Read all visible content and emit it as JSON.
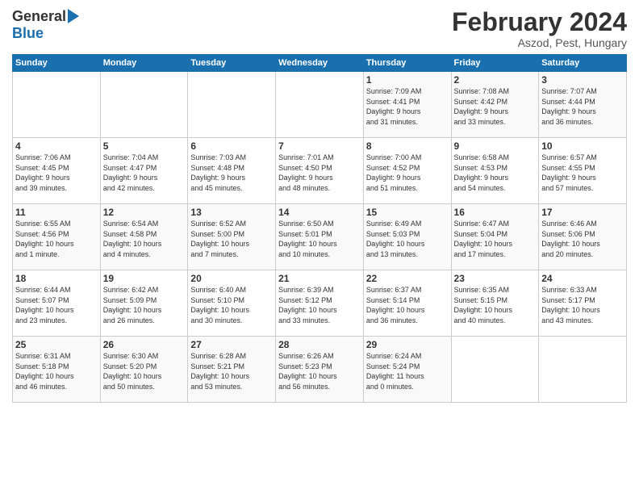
{
  "logo": {
    "general": "General",
    "blue": "Blue"
  },
  "title": "February 2024",
  "subtitle": "Aszod, Pest, Hungary",
  "weekdays": [
    "Sunday",
    "Monday",
    "Tuesday",
    "Wednesday",
    "Thursday",
    "Friday",
    "Saturday"
  ],
  "weeks": [
    [
      {
        "day": "",
        "info": ""
      },
      {
        "day": "",
        "info": ""
      },
      {
        "day": "",
        "info": ""
      },
      {
        "day": "",
        "info": ""
      },
      {
        "day": "1",
        "info": "Sunrise: 7:09 AM\nSunset: 4:41 PM\nDaylight: 9 hours\nand 31 minutes."
      },
      {
        "day": "2",
        "info": "Sunrise: 7:08 AM\nSunset: 4:42 PM\nDaylight: 9 hours\nand 33 minutes."
      },
      {
        "day": "3",
        "info": "Sunrise: 7:07 AM\nSunset: 4:44 PM\nDaylight: 9 hours\nand 36 minutes."
      }
    ],
    [
      {
        "day": "4",
        "info": "Sunrise: 7:06 AM\nSunset: 4:45 PM\nDaylight: 9 hours\nand 39 minutes."
      },
      {
        "day": "5",
        "info": "Sunrise: 7:04 AM\nSunset: 4:47 PM\nDaylight: 9 hours\nand 42 minutes."
      },
      {
        "day": "6",
        "info": "Sunrise: 7:03 AM\nSunset: 4:48 PM\nDaylight: 9 hours\nand 45 minutes."
      },
      {
        "day": "7",
        "info": "Sunrise: 7:01 AM\nSunset: 4:50 PM\nDaylight: 9 hours\nand 48 minutes."
      },
      {
        "day": "8",
        "info": "Sunrise: 7:00 AM\nSunset: 4:52 PM\nDaylight: 9 hours\nand 51 minutes."
      },
      {
        "day": "9",
        "info": "Sunrise: 6:58 AM\nSunset: 4:53 PM\nDaylight: 9 hours\nand 54 minutes."
      },
      {
        "day": "10",
        "info": "Sunrise: 6:57 AM\nSunset: 4:55 PM\nDaylight: 9 hours\nand 57 minutes."
      }
    ],
    [
      {
        "day": "11",
        "info": "Sunrise: 6:55 AM\nSunset: 4:56 PM\nDaylight: 10 hours\nand 1 minute."
      },
      {
        "day": "12",
        "info": "Sunrise: 6:54 AM\nSunset: 4:58 PM\nDaylight: 10 hours\nand 4 minutes."
      },
      {
        "day": "13",
        "info": "Sunrise: 6:52 AM\nSunset: 5:00 PM\nDaylight: 10 hours\nand 7 minutes."
      },
      {
        "day": "14",
        "info": "Sunrise: 6:50 AM\nSunset: 5:01 PM\nDaylight: 10 hours\nand 10 minutes."
      },
      {
        "day": "15",
        "info": "Sunrise: 6:49 AM\nSunset: 5:03 PM\nDaylight: 10 hours\nand 13 minutes."
      },
      {
        "day": "16",
        "info": "Sunrise: 6:47 AM\nSunset: 5:04 PM\nDaylight: 10 hours\nand 17 minutes."
      },
      {
        "day": "17",
        "info": "Sunrise: 6:46 AM\nSunset: 5:06 PM\nDaylight: 10 hours\nand 20 minutes."
      }
    ],
    [
      {
        "day": "18",
        "info": "Sunrise: 6:44 AM\nSunset: 5:07 PM\nDaylight: 10 hours\nand 23 minutes."
      },
      {
        "day": "19",
        "info": "Sunrise: 6:42 AM\nSunset: 5:09 PM\nDaylight: 10 hours\nand 26 minutes."
      },
      {
        "day": "20",
        "info": "Sunrise: 6:40 AM\nSunset: 5:10 PM\nDaylight: 10 hours\nand 30 minutes."
      },
      {
        "day": "21",
        "info": "Sunrise: 6:39 AM\nSunset: 5:12 PM\nDaylight: 10 hours\nand 33 minutes."
      },
      {
        "day": "22",
        "info": "Sunrise: 6:37 AM\nSunset: 5:14 PM\nDaylight: 10 hours\nand 36 minutes."
      },
      {
        "day": "23",
        "info": "Sunrise: 6:35 AM\nSunset: 5:15 PM\nDaylight: 10 hours\nand 40 minutes."
      },
      {
        "day": "24",
        "info": "Sunrise: 6:33 AM\nSunset: 5:17 PM\nDaylight: 10 hours\nand 43 minutes."
      }
    ],
    [
      {
        "day": "25",
        "info": "Sunrise: 6:31 AM\nSunset: 5:18 PM\nDaylight: 10 hours\nand 46 minutes."
      },
      {
        "day": "26",
        "info": "Sunrise: 6:30 AM\nSunset: 5:20 PM\nDaylight: 10 hours\nand 50 minutes."
      },
      {
        "day": "27",
        "info": "Sunrise: 6:28 AM\nSunset: 5:21 PM\nDaylight: 10 hours\nand 53 minutes."
      },
      {
        "day": "28",
        "info": "Sunrise: 6:26 AM\nSunset: 5:23 PM\nDaylight: 10 hours\nand 56 minutes."
      },
      {
        "day": "29",
        "info": "Sunrise: 6:24 AM\nSunset: 5:24 PM\nDaylight: 11 hours\nand 0 minutes."
      },
      {
        "day": "",
        "info": ""
      },
      {
        "day": "",
        "info": ""
      }
    ]
  ]
}
